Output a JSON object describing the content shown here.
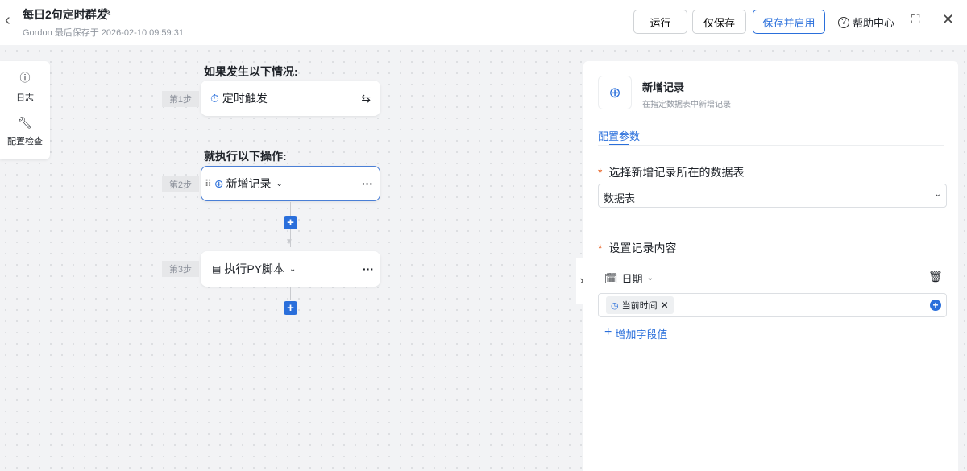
{
  "header": {
    "title": "每日2句定时群发",
    "subtitle": "Gordon 最后保存于 2026-02-10 09:59:31",
    "run": "运行",
    "save_only": "仅保存",
    "save_enable": "保存并启用",
    "help": "帮助中心"
  },
  "side_tools": [
    {
      "label": "日志"
    },
    {
      "label": "配置检查"
    }
  ],
  "flow": {
    "trigger_heading": "如果发生以下情况:",
    "action_heading": "就执行以下操作:",
    "steps": [
      {
        "step": "第1步",
        "label": "定时触发"
      },
      {
        "step": "第2步",
        "label": "新增记录"
      },
      {
        "step": "第3步",
        "label": "执行PY脚本"
      }
    ]
  },
  "panel": {
    "title": "新增记录",
    "desc": "在指定数据表中新增记录",
    "tab": "配置参数",
    "table_label": "选择新增记录所在的数据表",
    "table_value": "数据表",
    "content_label": "设置记录内容",
    "field_name": "日期",
    "field_value": "当前时间",
    "add_field": "增加字段值"
  },
  "colors": {
    "accent": "#2a6fdb",
    "required": "#e8672b"
  }
}
